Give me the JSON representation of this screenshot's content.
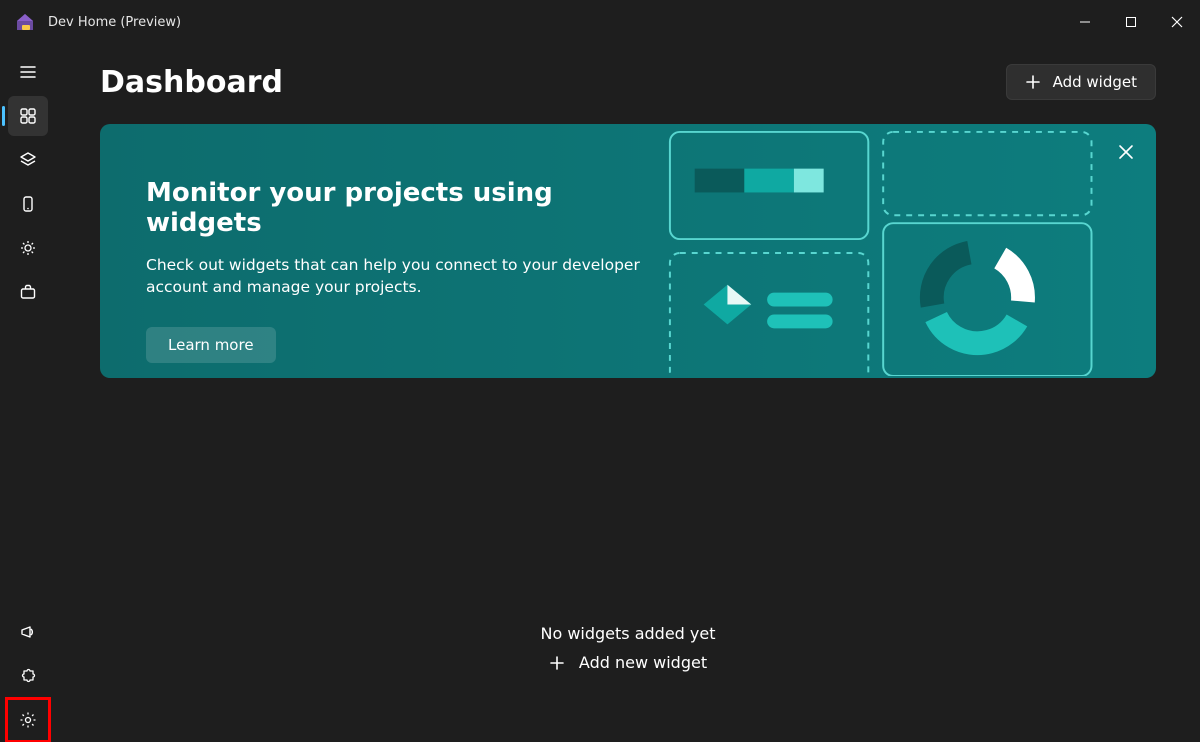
{
  "window": {
    "title": "Dev Home (Preview)"
  },
  "header": {
    "page_title": "Dashboard",
    "add_widget_label": "Add widget"
  },
  "banner": {
    "title": "Monitor your projects using widgets",
    "subtitle": "Check out widgets that can help you connect to your developer account and manage your projects.",
    "learn_more": "Learn more"
  },
  "empty_state": {
    "message": "No widgets added yet",
    "add_label": "Add new widget"
  },
  "sidebar": {
    "items": [
      {
        "name": "menu"
      },
      {
        "name": "dashboard",
        "selected": true
      },
      {
        "name": "stack"
      },
      {
        "name": "device"
      },
      {
        "name": "utilities"
      },
      {
        "name": "toolbox"
      }
    ],
    "bottom_items": [
      {
        "name": "feedback"
      },
      {
        "name": "extensions"
      },
      {
        "name": "settings",
        "highlighted": true
      }
    ]
  }
}
